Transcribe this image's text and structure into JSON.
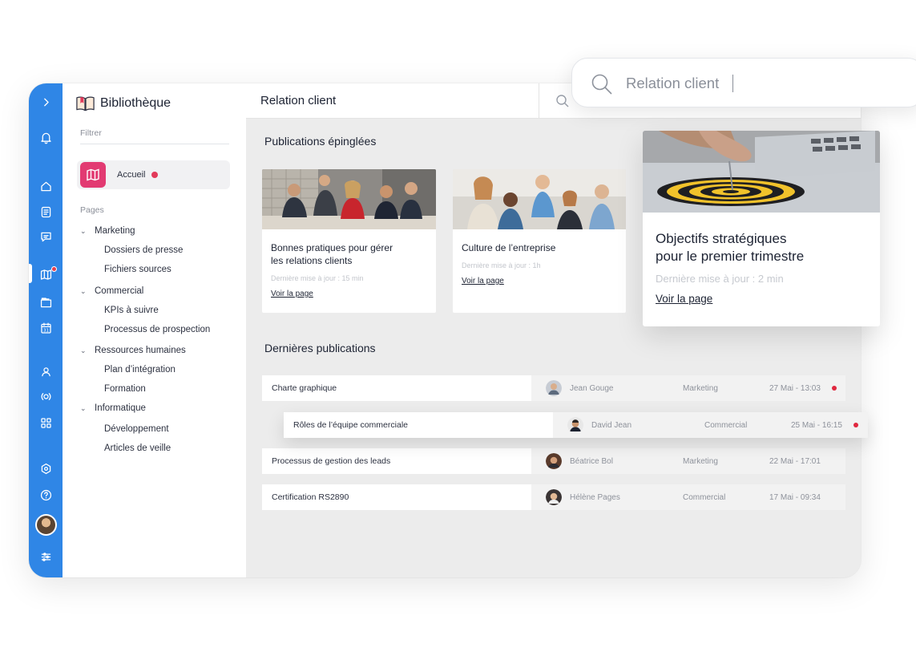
{
  "search": {
    "query": "Relation client"
  },
  "sidebar": {
    "title": "Bibliothèque",
    "filter_label": "Filtrer",
    "home": {
      "label": "Accueil",
      "has_notification": true
    },
    "pages_label": "Pages",
    "tree": [
      {
        "label": "Marketing",
        "children": [
          "Dossiers de presse",
          "Fichiers sources"
        ]
      },
      {
        "label": "Commercial",
        "children": [
          "KPIs à suivre",
          "Processus de prospection"
        ]
      },
      {
        "label": "Ressources humaines",
        "children": [
          "Plan d’intégration",
          "Formation"
        ]
      },
      {
        "label": "Informatique",
        "children": [
          "Développement",
          "Articles de veille"
        ]
      }
    ]
  },
  "rail": {
    "icons": [
      "chevron-right-icon",
      "bell-icon",
      "home-icon",
      "document-icon",
      "chat-icon",
      "library-icon",
      "folder-icon",
      "calendar-icon",
      "people-icon",
      "broadcast-icon",
      "apps-icon",
      "settings-icon",
      "help-icon",
      "avatar",
      "sliders-icon"
    ],
    "calendar_day": "31"
  },
  "main": {
    "title": "Relation client",
    "pinned_heading": "Publications épinglées",
    "latest_heading": "Dernières publications",
    "pinned": [
      {
        "title_line1": "Bonnes pratiques pour gérer",
        "title_line2": "les relations clients",
        "meta": "Dernière mise à jour : 15 min",
        "link": "Voir la page"
      },
      {
        "title_line1": "Culture de l’entreprise",
        "title_line2": "",
        "meta": "Dernière mise à jour : 1h",
        "link": "Voir la page"
      },
      {
        "title_line1": "Objectifs stratégiques",
        "title_line2": "pour le premier trimestre",
        "meta": "Dernière mise à jour : 2 min",
        "link": "Voir la page"
      }
    ],
    "latest": [
      {
        "name": "Charte graphique",
        "author": "Jean Gouge",
        "category": "Marketing",
        "date": "27 Mai - 13:03",
        "unread": true
      },
      {
        "name": "Rôles de l’équipe commerciale",
        "author": "David Jean",
        "category": "Commercial",
        "date": "25 Mai - 16:15",
        "unread": true
      },
      {
        "name": "Processus de gestion des leads",
        "author": "Béatrice Bol",
        "category": "Marketing",
        "date": "22 Mai - 17:01",
        "unread": false
      },
      {
        "name": "Certification RS2890",
        "author": "Hélène Pages",
        "category": "Commercial",
        "date": "17 Mai - 09:34",
        "unread": false
      }
    ]
  },
  "colors": {
    "rail_blue": "#2f86e6",
    "home_pink": "#e23a72",
    "unread_red": "#e0283f",
    "background_gray": "#ececec"
  }
}
